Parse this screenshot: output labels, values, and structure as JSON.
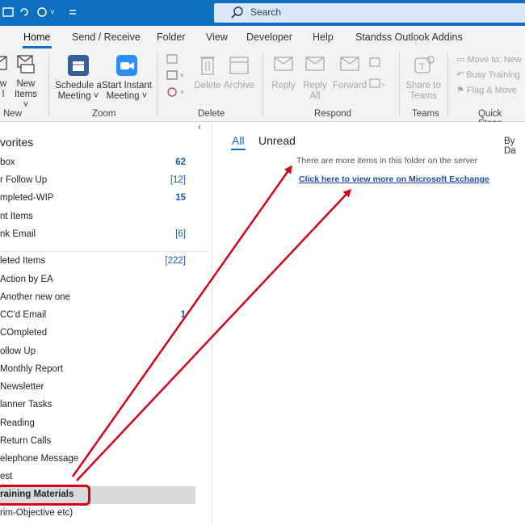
{
  "search": {
    "placeholder": "Search"
  },
  "tabs": [
    {
      "label": "Home"
    },
    {
      "label": "Send / Receive"
    },
    {
      "label": "Folder"
    },
    {
      "label": "View"
    },
    {
      "label": "Developer"
    },
    {
      "label": "Help"
    },
    {
      "label": "Standss Outlook Addins"
    }
  ],
  "ribbon": {
    "new_email": {
      "line1": "w",
      "line2": "l"
    },
    "new_items": {
      "line1": "New",
      "line2": "Items ˅"
    },
    "schedule_meeting": {
      "line1": "Schedule a",
      "line2": "Meeting ˅"
    },
    "instant_meeting": {
      "line1": "Start Instant",
      "line2": "Meeting ˅"
    },
    "delete": {
      "label": "Delete"
    },
    "archive": {
      "label": "Archive"
    },
    "reply": {
      "label": "Reply"
    },
    "reply_all": {
      "line1": "Reply",
      "line2": "All"
    },
    "forward": {
      "label": "Forward"
    },
    "share_teams": {
      "line1": "Share to",
      "line2": "Teams"
    },
    "quick_steps": [
      "Move to: New",
      "Busy Training",
      "Flag & Move"
    ],
    "groups": {
      "new": "New",
      "zoom": "Zoom",
      "delete": "Delete",
      "respond": "Respond",
      "teams": "Teams",
      "quick_steps": "Quick Steps"
    }
  },
  "sidebar": {
    "favorites_title": "vorites",
    "favorites": [
      {
        "label": "box",
        "count": "62",
        "bold": true
      },
      {
        "label": "r Follow Up",
        "count": "[12]",
        "bold": false
      },
      {
        "label": "mpleted-WIP",
        "count": "15",
        "bold": true
      },
      {
        "label": "nt Items",
        "count": "",
        "bold": false
      },
      {
        "label": "nk Email",
        "count": "[6]",
        "bold": false
      }
    ],
    "folders": [
      {
        "label": "leted Items",
        "count": "[222]"
      },
      {
        "label": "Action by EA",
        "count": ""
      },
      {
        "label": "Another new one",
        "count": ""
      },
      {
        "label": "CC'd Email",
        "count": "1"
      },
      {
        "label": "COmpleted",
        "count": ""
      },
      {
        "label": "ollow Up",
        "count": ""
      },
      {
        "label": "Monthly Report",
        "count": ""
      },
      {
        "label": "Newsletter",
        "count": ""
      },
      {
        "label": "lanner Tasks",
        "count": ""
      },
      {
        "label": "Reading",
        "count": ""
      },
      {
        "label": "Return Calls",
        "count": ""
      },
      {
        "label": "elephone Message",
        "count": ""
      },
      {
        "label": "est",
        "count": ""
      },
      {
        "label": "raining Materials",
        "count": ""
      },
      {
        "label": "rim-Objective etc)",
        "count": ""
      }
    ]
  },
  "main": {
    "filter_all": "All",
    "filter_unread": "Unread",
    "sort_label": "By Da",
    "more_items_message": "There are more items in this folder on the server",
    "exchange_link": "Click here to view more on Microsoft Exchange"
  },
  "colors": {
    "accent": "#106ebe",
    "annotation": "#d0021b"
  }
}
